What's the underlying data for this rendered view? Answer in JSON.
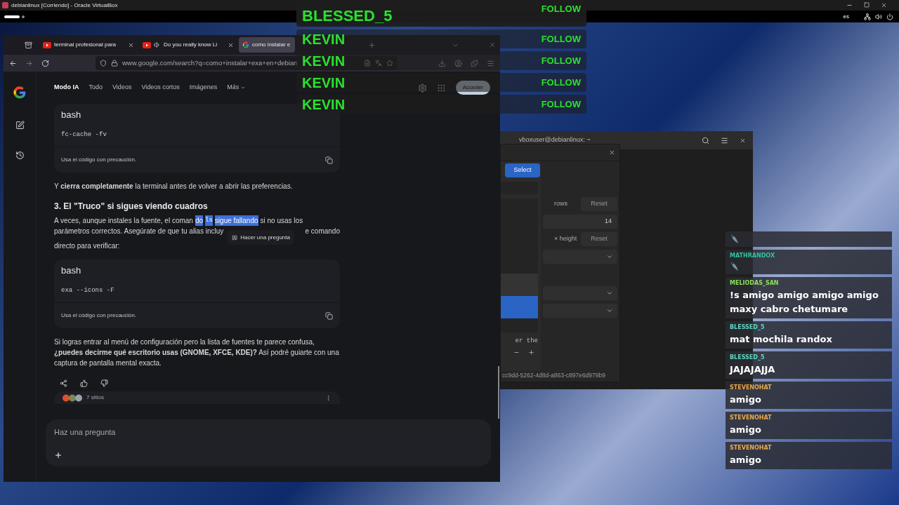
{
  "vbox_window": {
    "title": "debianlinux [Corriendo] - Oracle VirtualBox"
  },
  "top_bar": {
    "workspaces": [
      {
        "selected": true
      },
      {
        "selected": false
      }
    ],
    "keyboard_layout": "es"
  },
  "browser": {
    "tabs": [
      {
        "title": "terminal profesional para",
        "kind": "video",
        "selected": false
      },
      {
        "title": "Do you really know Li",
        "kind": "audio",
        "selected": false
      },
      {
        "title": "como instalar e",
        "kind": "search",
        "selected": true
      }
    ],
    "url": "www.google.com/search?q=como+instalar+exa+en+debian",
    "nav": [
      {
        "label": "Modo IA",
        "selected": true
      },
      {
        "label": "Todo",
        "selected": false
      },
      {
        "label": "Videos",
        "selected": false
      },
      {
        "label": "Videos cortos",
        "selected": false
      },
      {
        "label": "Imágenes",
        "selected": false
      }
    ],
    "more": "Más",
    "sign_in": "Acceder",
    "blocks": [
      {
        "kind": "code",
        "language": "bash",
        "code": "fc-cache -fv",
        "caution": "Usa el código con precaución."
      },
      {
        "kind": "paragraph",
        "text": "Y **cierra completamente** la terminal antes de volver a abrir las preferencias."
      },
      {
        "kind": "heading",
        "text": "3. El \"Truco\" si sigues viendo cuadros"
      },
      {
        "kind": "selection",
        "line1": [
          {
            "text": "A veces, aunque instales la fuente, el coman",
            "highlighted": false,
            "code": false
          },
          {
            "text": "do",
            "highlighted": true,
            "code": false
          },
          {
            "text": "ls",
            "highlighted": true,
            "code": true
          },
          {
            "text": "sigue fallando",
            "highlighted": true,
            "code": false
          },
          {
            "text": "si no usas los",
            "highlighted": false,
            "code": false
          }
        ],
        "line2_start": "parámetros correctos. Asegúrate de que tu alias incluy",
        "tooltip": "Hacer una pregunta",
        "line2_end": "e comando",
        "line3": "directo para verificar:"
      },
      {
        "kind": "code",
        "language": "bash",
        "code": "exa --icons -F",
        "caution": "Usa el código con precaución."
      },
      {
        "kind": "paragraph",
        "text": "Si logras entrar al menú de configuración pero la lista de fuentes te parece confusa, **¿puedes decirme qué escritorio usas (GNOME, XFCE, KDE)?** Así podré guiarte con una captura de pantalla mental exacta."
      }
    ],
    "sources": "7 sitios",
    "ask_placeholder": "Haz una pregunta"
  },
  "terminal": {
    "title": "vboxuser@debianlinux: ~"
  },
  "preferences": {
    "select": "Select",
    "list_rows": [
      {
        "selected": false
      },
      {
        "selected": true
      }
    ],
    "preview": "er the",
    "rows_label": "rows",
    "rows_reset": "Reset",
    "font_size": "14",
    "height_label": "× height",
    "height_reset": "Reset",
    "uuid": "cc9dd-5262-4d8d-a863-c897e6d979b9"
  },
  "follow_overlay": [
    {
      "name": "BLESSED_5",
      "action": "FOLLOW",
      "kind": "large"
    },
    {
      "name": "KEVIN",
      "action": "FOLLOW",
      "kind": "small"
    },
    {
      "name": "KEVIN",
      "action": "FOLLOW",
      "kind": "small"
    },
    {
      "name": "KEVIN",
      "action": "FOLLOW",
      "kind": "small"
    },
    {
      "name": "KEVIN",
      "action": "FOLLOW",
      "kind": "small"
    }
  ],
  "chat": [
    {
      "kind": "emote"
    },
    {
      "kind": "emote",
      "user": "MATHRANDOX",
      "color": "#2ec4a0"
    },
    {
      "kind": "text",
      "user": "MELIODAS_SAN",
      "color": "#8de05a",
      "message": "!s amigo amigo amigo amigo maxy cabro chetumare"
    },
    {
      "kind": "text",
      "user": "BLESSED_5",
      "color": "#5fd4c0",
      "message": "mat mochila randox"
    },
    {
      "kind": "text",
      "user": "BLESSED_5",
      "color": "#5fd4c0",
      "message": "JAJAJAJJA"
    },
    {
      "kind": "text",
      "user": "STEVENOHAT",
      "color": "#e8a84a",
      "message": "amigo"
    },
    {
      "kind": "text",
      "user": "STEVENOHAT",
      "color": "#e8a84a",
      "message": "amigo"
    },
    {
      "kind": "text",
      "user": "STEVENOHAT",
      "color": "#e8a84a",
      "message": "amigo"
    }
  ]
}
